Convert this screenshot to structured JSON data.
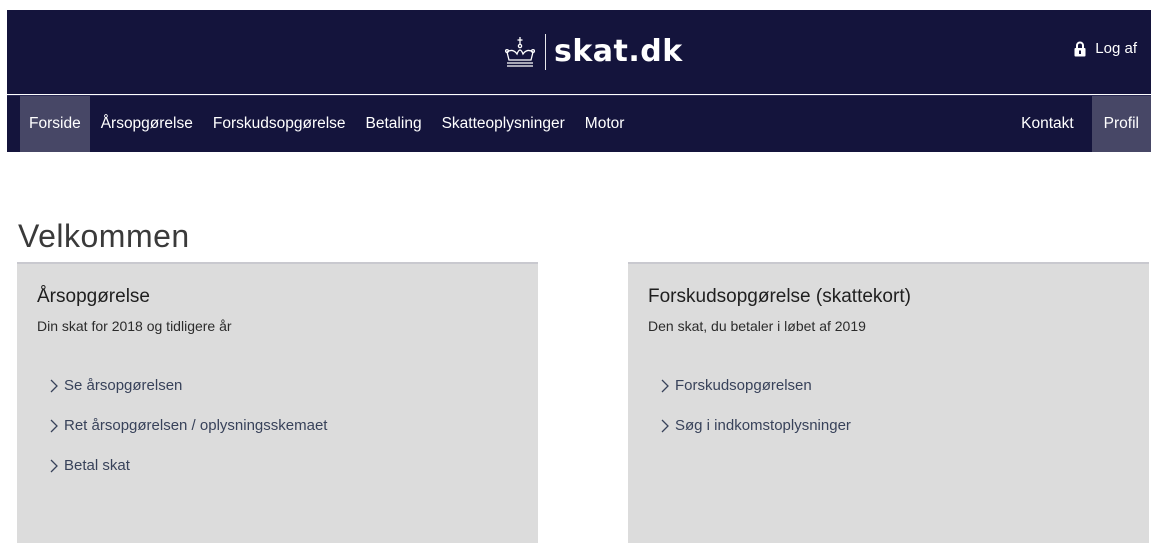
{
  "header": {
    "logo_text": "skat.dk",
    "logout_label": "Log af"
  },
  "nav": {
    "left": [
      {
        "label": "Forside",
        "active": true
      },
      {
        "label": "Årsopgørelse"
      },
      {
        "label": "Forskudsopgørelse"
      },
      {
        "label": "Betaling"
      },
      {
        "label": "Skatteoplysninger"
      },
      {
        "label": "Motor"
      }
    ],
    "right": [
      {
        "label": "Kontakt"
      },
      {
        "label": "Profil",
        "active": true
      }
    ]
  },
  "main": {
    "heading": "Velkommen",
    "cards": [
      {
        "title": "Årsopgørelse",
        "subtitle": "Din skat for 2018 og tidligere år",
        "links": [
          {
            "label": "Se årsopgørelsen"
          },
          {
            "label": "Ret årsopgørelsen / oplysningsskemaet"
          },
          {
            "label": "Betal skat"
          }
        ]
      },
      {
        "title": "Forskudsopgørelse (skattekort)",
        "subtitle": "Den skat, du betaler i løbet af 2019",
        "links": [
          {
            "label": "Forskudsopgørelsen"
          },
          {
            "label": "Søg i indkomstoplysninger"
          }
        ]
      }
    ]
  },
  "colors": {
    "header_bg": "#14143c",
    "nav_active_bg": "#474766",
    "card_bg": "#dcdcdc",
    "link_color": "#38425a"
  },
  "icons": {
    "logo": "crown-icon",
    "logout": "lock-icon",
    "link": "chevron-right-icon"
  }
}
